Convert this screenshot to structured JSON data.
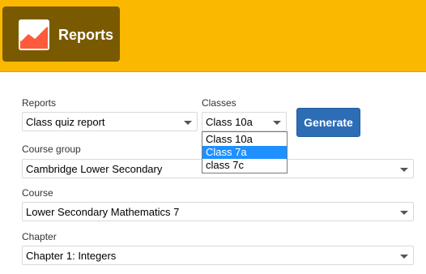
{
  "header": {
    "title": "Reports",
    "icon": "line-chart-icon"
  },
  "form": {
    "reports": {
      "label": "Reports",
      "value": "Class quiz report"
    },
    "classes": {
      "label": "Classes",
      "value": "Class 10a",
      "options": [
        "Class 10a",
        "Class 7a",
        "class 7c"
      ],
      "highlighted": "Class 7a"
    },
    "generate_label": "Generate",
    "course_group": {
      "label": "Course group",
      "value": "Cambridge Lower Secondary"
    },
    "course": {
      "label": "Course",
      "value": "Lower Secondary Mathematics 7"
    },
    "chapter": {
      "label": "Chapter",
      "value": "Chapter 1: Integers"
    }
  },
  "colors": {
    "header": "#fbb800",
    "brand": "#7a5a00",
    "button": "#2d6db5",
    "highlight": "#1e90ff"
  }
}
